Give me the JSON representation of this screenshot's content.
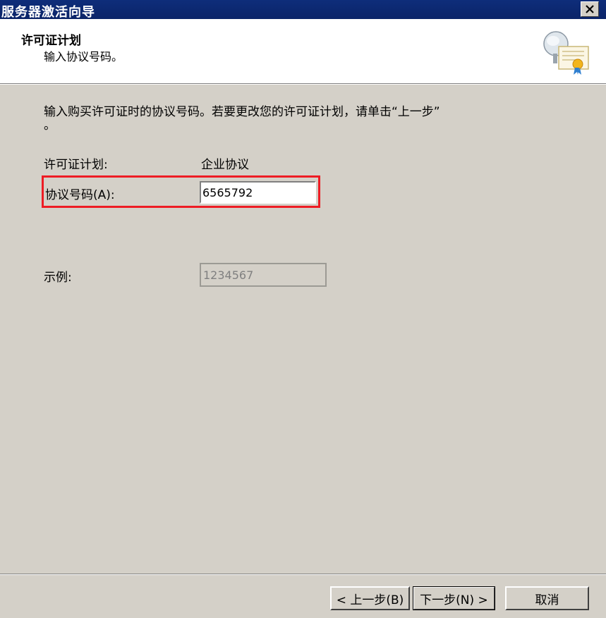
{
  "window": {
    "title": "服务器激活向导",
    "close_icon": "close-icon"
  },
  "header": {
    "title": "许可证计划",
    "subtitle": "输入协议号码。",
    "icon": "server-certificate-icon"
  },
  "content": {
    "intro_line1": "输入购买许可证时的协议号码。若要更改您的许可证计划，请单击“上一步”",
    "intro_line2": "。",
    "license_plan_label": "许可证计划:",
    "license_plan_value": "企业协议",
    "agreement_number_label": "协议号码(A):",
    "agreement_number_value": "6565792",
    "example_label": "示例:",
    "example_value": "1234567"
  },
  "buttons": {
    "back": "< 上一步(B)",
    "next": "下一步(N) >",
    "cancel": "取消"
  },
  "colors": {
    "titlebar": "#0e2d7a",
    "dialog_face": "#d4d0c8",
    "highlight": "#ee1c24"
  }
}
